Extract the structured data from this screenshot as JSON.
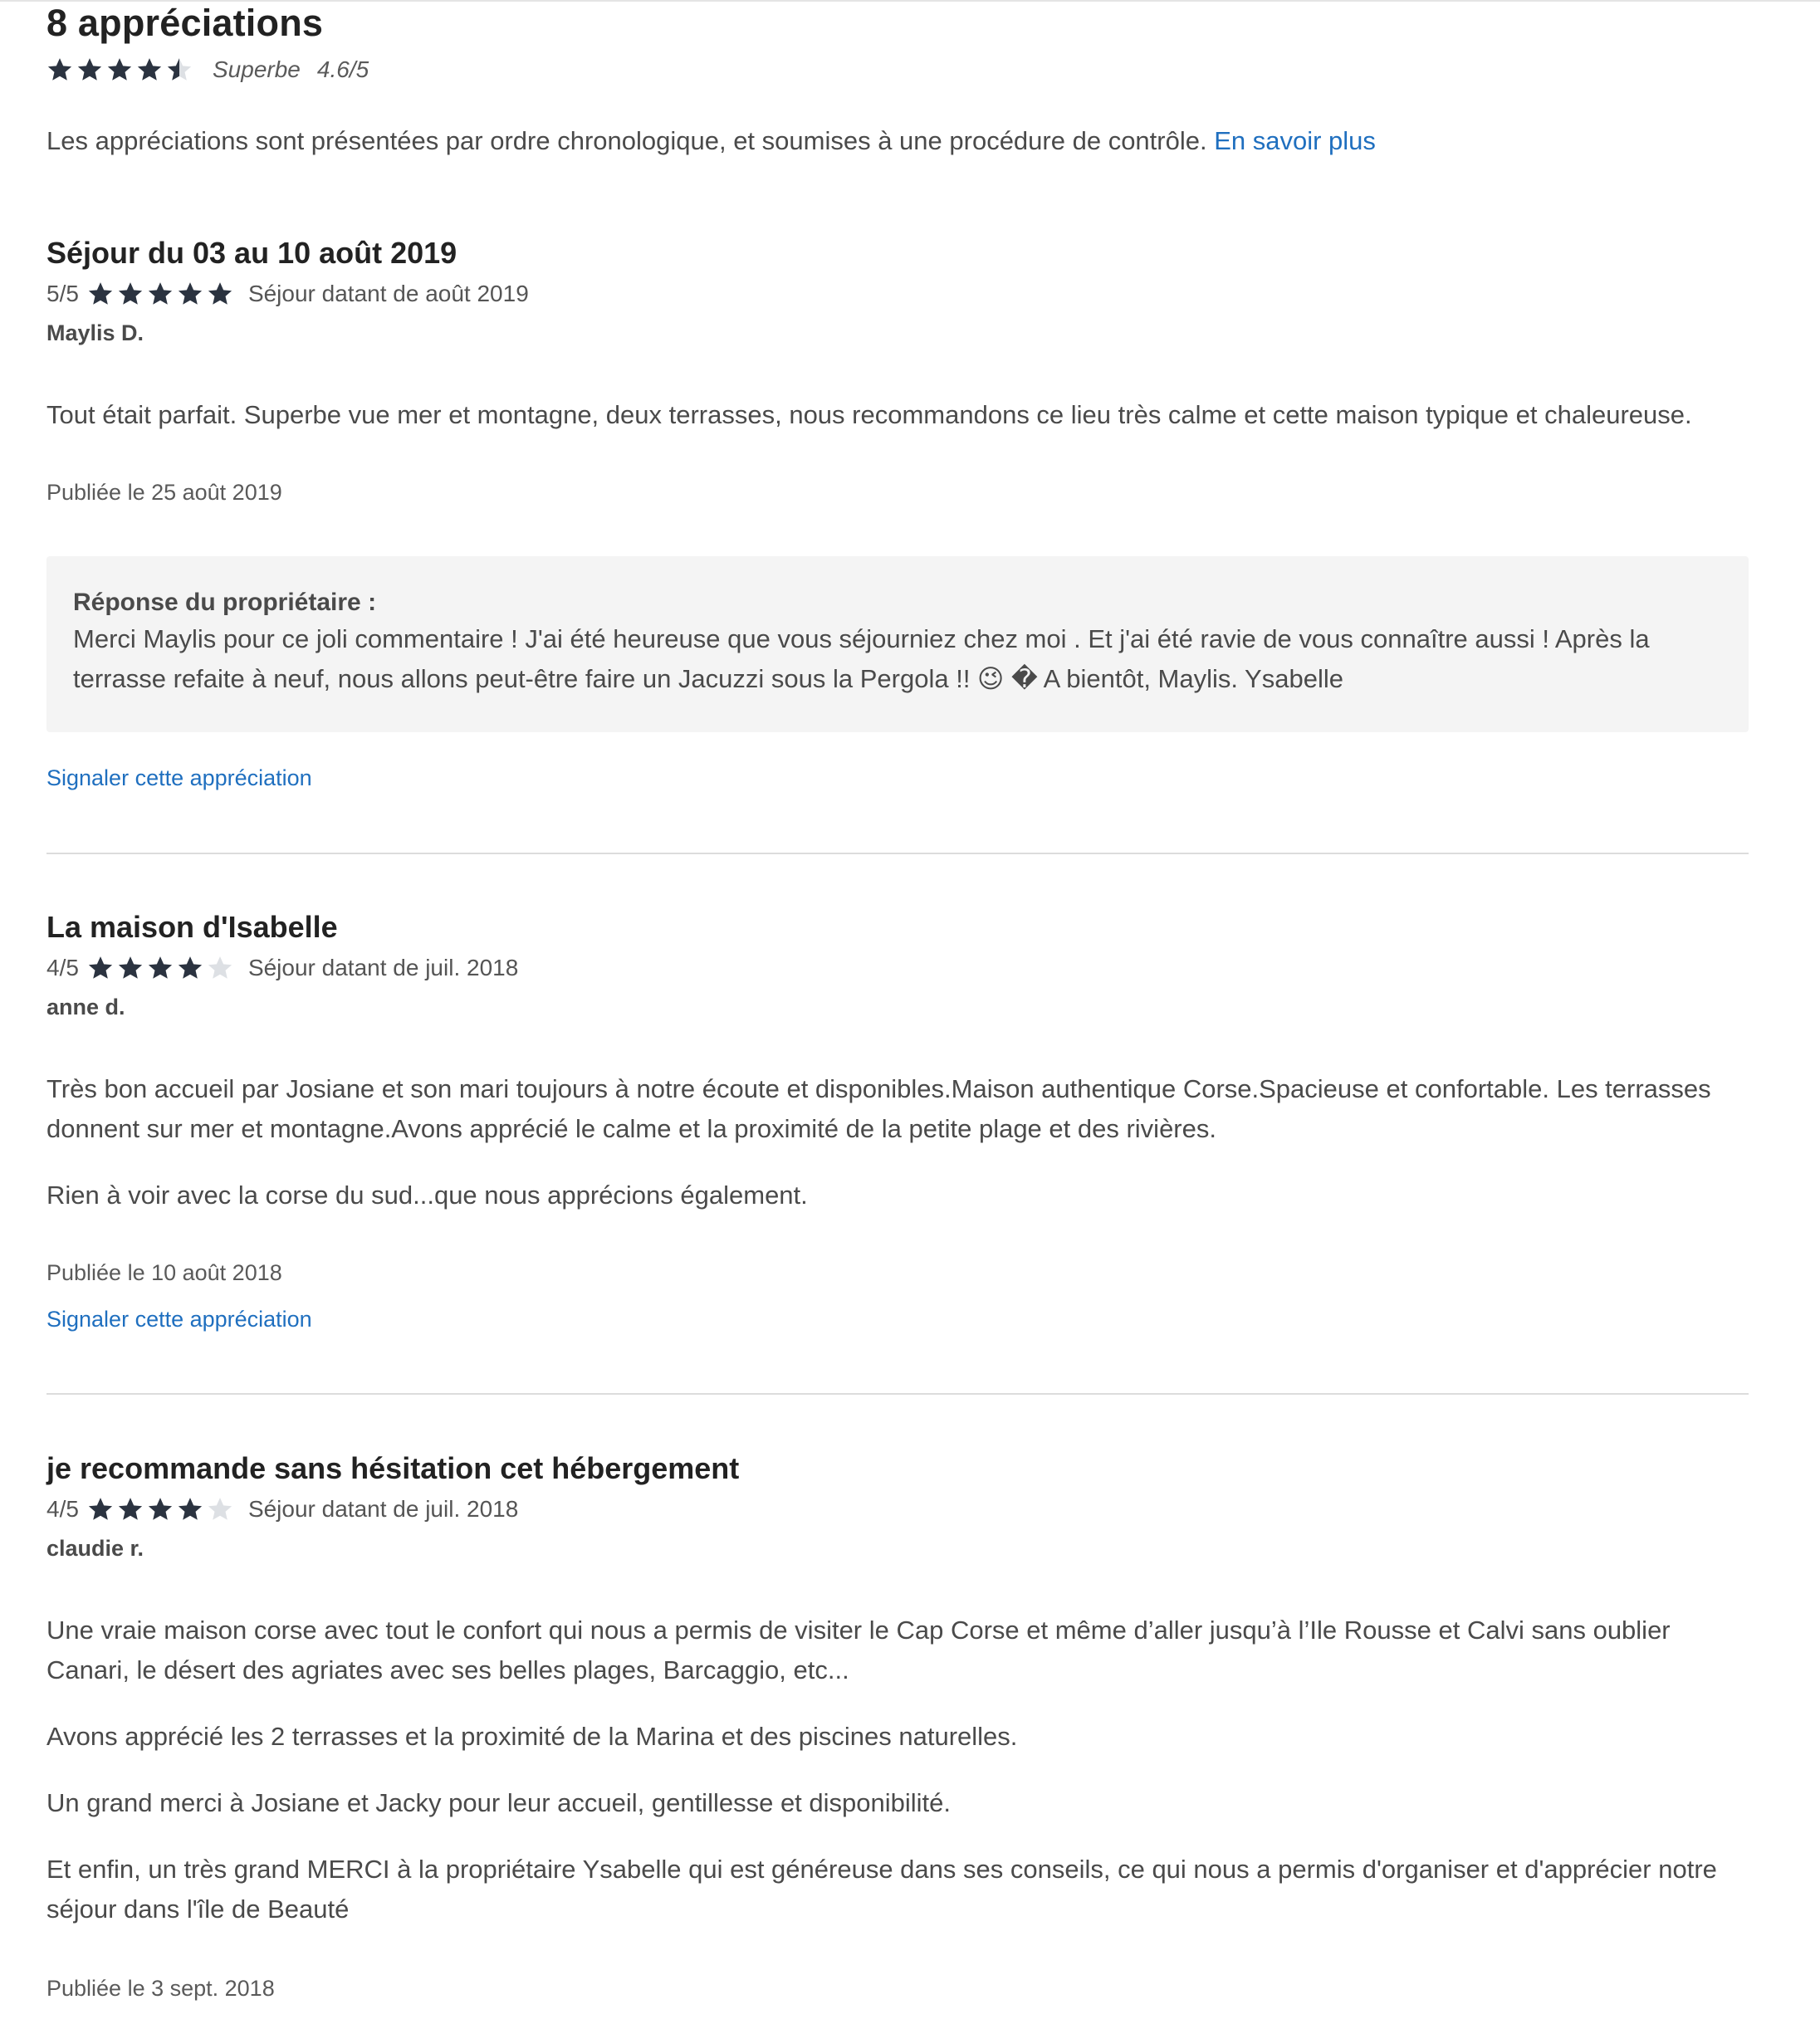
{
  "summary": {
    "title": "8 appréciations",
    "rating_stars": 4.5,
    "label": "Superbe",
    "score": "4.6/5"
  },
  "intro": {
    "text": "Les appréciations sont présentées par ordre chronologique, et soumises à une procédure de contrôle. ",
    "link": "En savoir plus"
  },
  "colors": {
    "star_filled": "#2b3340",
    "star_empty": "#dde0e4",
    "link": "#1f6fbf"
  },
  "reviews": [
    {
      "title": "Séjour du 03 au 10 août 2019",
      "score": "5/5",
      "stars": 5,
      "stay": "Séjour datant de août 2019",
      "author": "Maylis D.",
      "paragraphs": [
        "Tout était parfait. Superbe vue mer et montagne, deux terrasses, nous recommandons ce lieu très calme et cette maison typique et chaleureuse."
      ],
      "published": "Publiée le 25 août 2019",
      "owner_label": "Réponse du propriétaire :",
      "owner_text": "Merci Maylis pour ce joli commentaire ! J'ai été heureuse que vous séjourniez chez moi . Et j'ai été ravie de vous connaître aussi ! Après la terrasse refaite à neuf, nous allons peut-être faire un Jacuzzi sous la Pergola !! 😉 � A bientôt, Maylis. Ysabelle",
      "report": "Signaler cette appréciation"
    },
    {
      "title": "La maison d'Isabelle",
      "score": "4/5",
      "stars": 4,
      "stay": "Séjour datant de juil. 2018",
      "author": "anne d.",
      "paragraphs": [
        "Très bon accueil par Josiane et son mari toujours à notre écoute et disponibles.Maison authentique Corse.Spacieuse et confortable. Les terrasses donnent sur mer et montagne.Avons apprécié le calme et la proximité de la petite plage et des rivières.",
        "Rien à voir avec la corse du sud...que nous apprécions également."
      ],
      "published": "Publiée le 10 août 2018",
      "report": "Signaler cette appréciation"
    },
    {
      "title": "je recommande sans hésitation cet hébergement",
      "score": "4/5",
      "stars": 4,
      "stay": "Séjour datant de juil. 2018",
      "author": "claudie r.",
      "paragraphs": [
        "Une vraie maison corse avec tout le confort qui nous a permis de visiter le Cap Corse et même d’aller jusqu’à l’Ile Rousse et Calvi sans oublier Canari, le désert des agriates avec ses belles plages, Barcaggio, etc...",
        "Avons apprécié les 2 terrasses et la proximité de la Marina et des piscines naturelles.",
        "Un grand merci à Josiane et Jacky pour leur accueil, gentillesse et disponibilité.",
        "Et enfin, un très grand MERCI à la propriétaire Ysabelle qui est généreuse dans ses conseils, ce qui nous a permis d'organiser et d'apprécier notre séjour dans l'île de Beauté"
      ],
      "published": "Publiée le 3 sept. 2018"
    }
  ]
}
